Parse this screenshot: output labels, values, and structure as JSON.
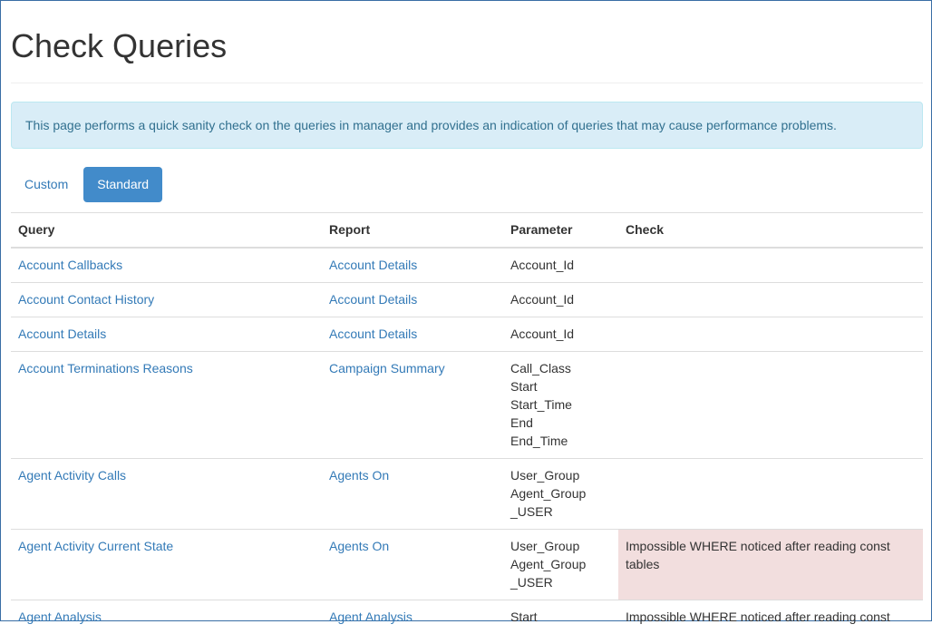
{
  "page": {
    "title": "Check Queries",
    "info": "This page performs a quick sanity check on the queries in manager and provides an indication of queries that may cause performance problems."
  },
  "tabs": [
    {
      "label": "Custom",
      "active": false
    },
    {
      "label": "Standard",
      "active": true
    }
  ],
  "table": {
    "headers": [
      "Query",
      "Report",
      "Parameter",
      "Check"
    ],
    "rows": [
      {
        "query": "Account Callbacks",
        "report": "Account Details",
        "params": [
          "Account_Id"
        ],
        "check": "",
        "warn": false
      },
      {
        "query": "Account Contact History",
        "report": "Account Details",
        "params": [
          "Account_Id"
        ],
        "check": "",
        "warn": false
      },
      {
        "query": "Account Details",
        "report": "Account Details",
        "params": [
          "Account_Id"
        ],
        "check": "",
        "warn": false
      },
      {
        "query": "Account Terminations Reasons",
        "report": "Campaign Summary",
        "params": [
          "Call_Class",
          "Start",
          "Start_Time",
          "End",
          "End_Time"
        ],
        "check": "",
        "warn": false
      },
      {
        "query": "Agent Activity Calls",
        "report": "Agents On",
        "params": [
          "User_Group",
          "Agent_Group",
          "_USER"
        ],
        "check": "",
        "warn": false
      },
      {
        "query": "Agent Activity Current State",
        "report": "Agents On",
        "params": [
          "User_Group",
          "Agent_Group",
          "_USER"
        ],
        "check": "Impossible WHERE noticed after reading const tables",
        "warn": true
      },
      {
        "query": "Agent Analysis",
        "report": "Agent Analysis",
        "params": [
          "Start"
        ],
        "check": "Impossible WHERE noticed after reading const",
        "warn": false
      }
    ]
  },
  "colors": {
    "link": "#337ab7",
    "primary": "#428bca",
    "info_bg": "#d9edf7",
    "warn_bg": "#f2dede"
  }
}
